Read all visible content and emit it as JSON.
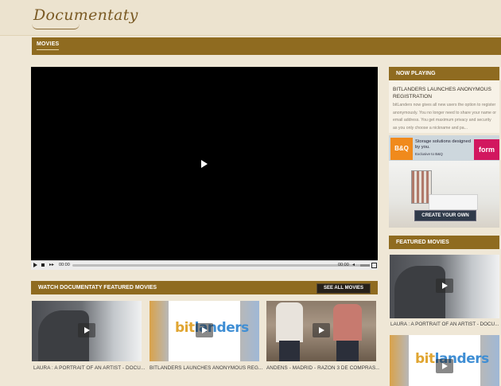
{
  "header": {
    "logo": "Documentaty"
  },
  "nav": {
    "items": [
      "MOVIES"
    ]
  },
  "player": {
    "time_current": "00:00",
    "time_total": "00:00"
  },
  "featured": {
    "title": "WATCH DOCUMENTATY FEATURED MOVIES",
    "see_all": "SEE ALL MOVIES",
    "items": [
      {
        "caption": "LAURA : A PORTRAIT OF AN ARTIST - DOCU..."
      },
      {
        "caption": "BITLANDERS LAUNCHES ANONYMOUS REG...",
        "logo_b": "bit",
        "logo_rest": "landers"
      },
      {
        "caption": "ANDÉNS - MADRID - RAZÓN 3 DE COMPRAS..."
      }
    ]
  },
  "sidebar": {
    "now_playing": {
      "title": "NOW PLAYING",
      "headline": "BITLANDERS LAUNCHES ANONYMOUS REGISTRATION",
      "body": "bitLanders now gives all new users the option to register anonymously. You no longer need to share your name or email address. You get maximum privacy and security as you only choose a nickname and pa..."
    },
    "ad": {
      "brand": "B&Q",
      "headline": "Storage solutions designed by you.",
      "sub": "Exclusive to B&Q",
      "form": "form",
      "cta": "CREATE YOUR OWN"
    },
    "featured_movies": {
      "title": "FEATURED MOVIES",
      "items": [
        {
          "caption": "LAURA : A PORTRAIT OF AN ARTIST - DOCU..."
        },
        {
          "caption": "",
          "logo_b": "bit",
          "logo_rest": "landers"
        }
      ]
    }
  }
}
